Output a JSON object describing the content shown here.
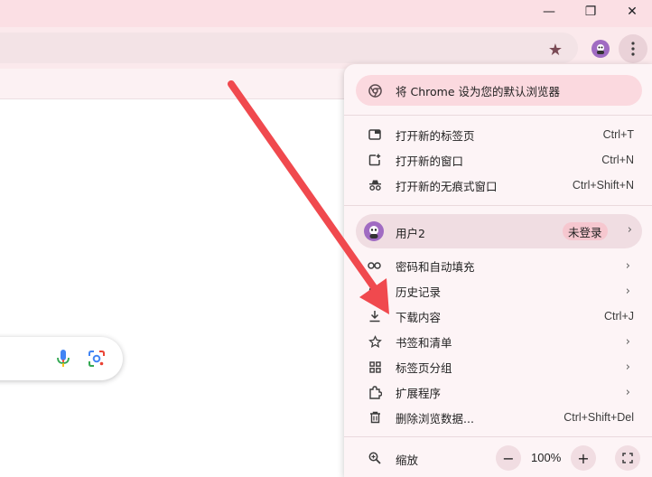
{
  "window": {
    "minimize_glyph": "—",
    "restore_glyph": "❐",
    "close_glyph": "✕"
  },
  "toolbar": {
    "bookmark_glyph": "★"
  },
  "menu": {
    "default_browser_banner": "将 Chrome 设为您的默认浏览器",
    "items_top": [
      {
        "label": "打开新的标签页",
        "shortcut": "Ctrl+T",
        "icon": "new-tab-icon"
      },
      {
        "label": "打开新的窗口",
        "shortcut": "Ctrl+N",
        "icon": "new-window-icon"
      },
      {
        "label": "打开新的无痕式窗口",
        "shortcut": "Ctrl+Shift+N",
        "icon": "incognito-icon"
      }
    ],
    "profile": {
      "name": "用户2",
      "status": "未登录"
    },
    "items_main": [
      {
        "label": "密码和自动填充",
        "icon": "key-icon",
        "submenu": true
      },
      {
        "label": "历史记录",
        "icon": "history-icon",
        "submenu": true
      },
      {
        "label": "下载内容",
        "shortcut": "Ctrl+J",
        "icon": "download-icon"
      },
      {
        "label": "书签和清单",
        "icon": "star-icon",
        "submenu": true
      },
      {
        "label": "标签页分组",
        "icon": "grid-icon",
        "submenu": true
      },
      {
        "label": "扩展程序",
        "icon": "puzzle-icon",
        "submenu": true
      },
      {
        "label": "删除浏览数据...",
        "shortcut": "Ctrl+Shift+Del",
        "icon": "trash-icon"
      }
    ],
    "zoom": {
      "label": "缩放",
      "value": "100%",
      "minus": "−",
      "plus": "+"
    },
    "chevron": "›"
  },
  "colors": {
    "arrow": "#f0494e",
    "menu_bg": "#fdf4f6",
    "banner_bg": "#fbd9df",
    "titlebar_bg": "#fbdfe4"
  }
}
